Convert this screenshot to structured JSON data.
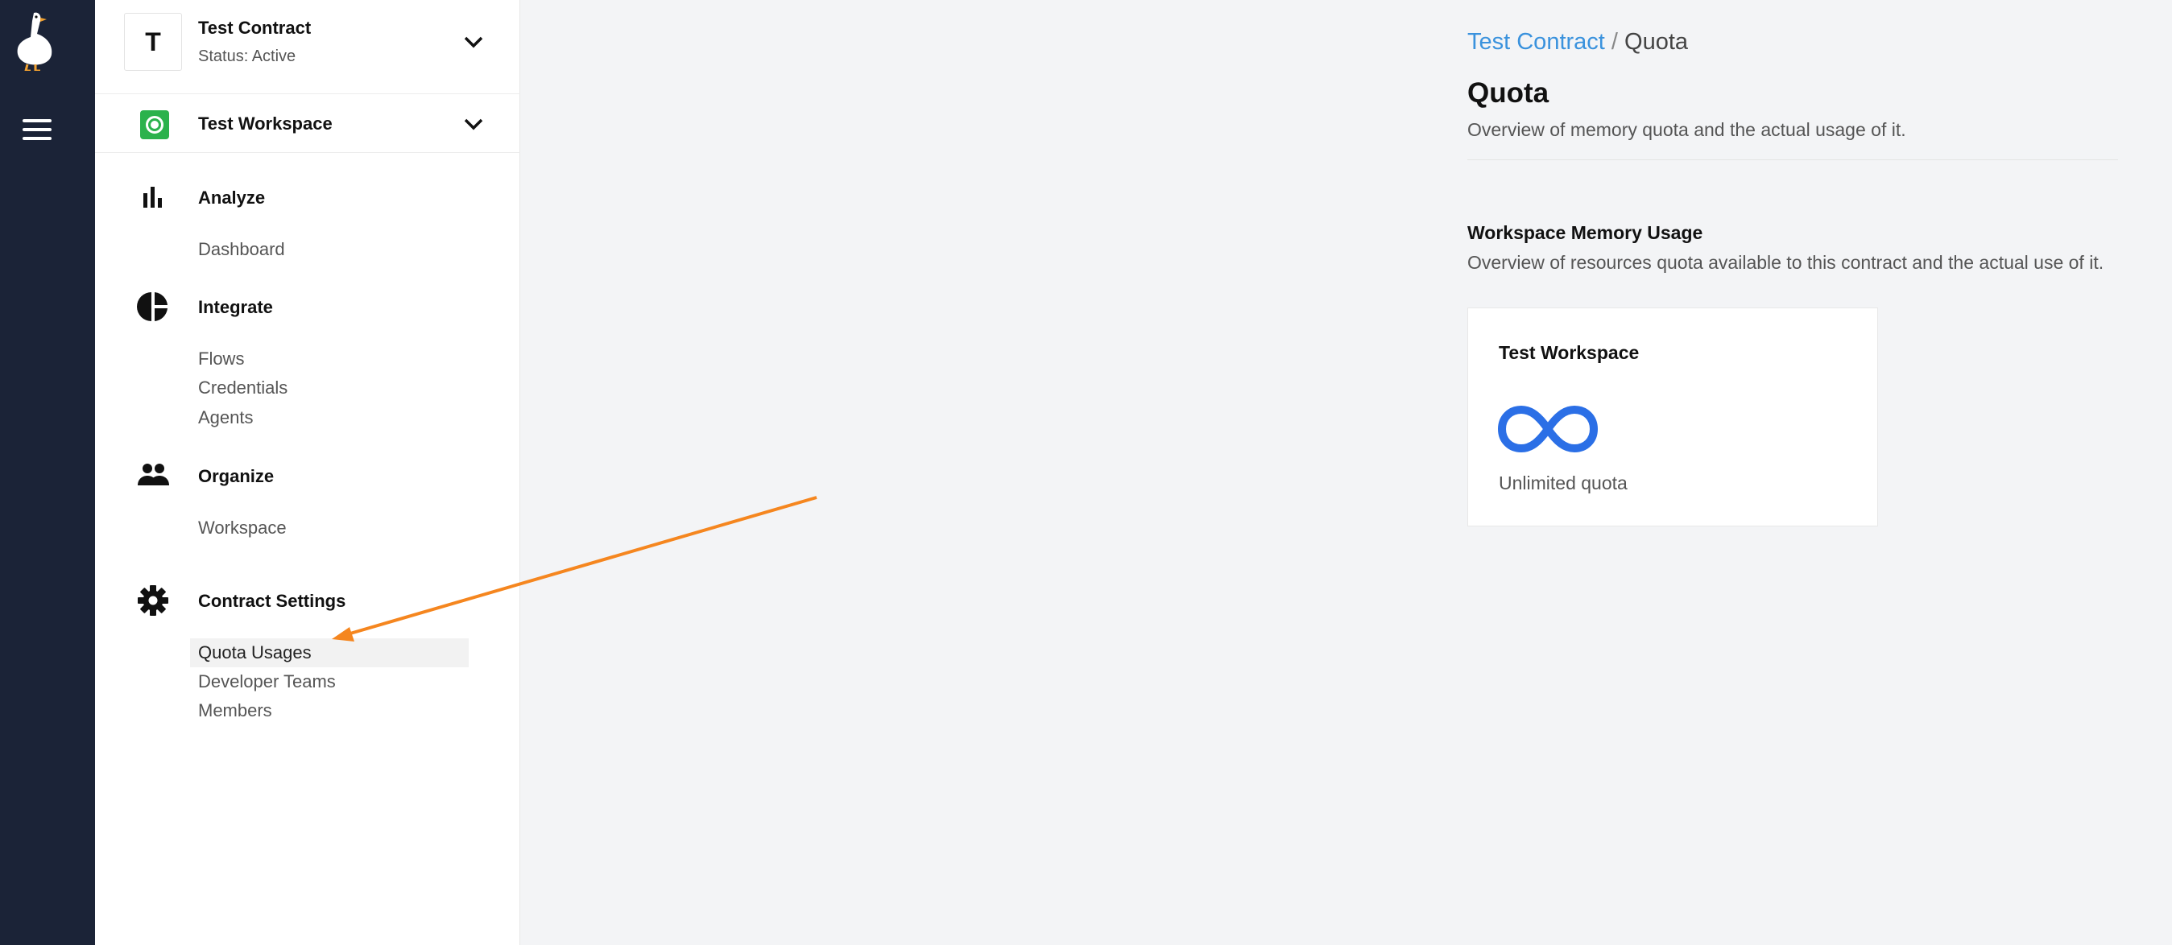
{
  "contract": {
    "avatar_letter": "T",
    "name": "Test Contract",
    "status": "Status: Active"
  },
  "workspace": {
    "name": "Test Workspace"
  },
  "nav": {
    "analyze": {
      "label": "Analyze",
      "items": [
        "Dashboard"
      ]
    },
    "integrate": {
      "label": "Integrate",
      "items": [
        "Flows",
        "Credentials",
        "Agents"
      ]
    },
    "organize": {
      "label": "Organize",
      "items": [
        "Workspace"
      ]
    },
    "contract_settings": {
      "label": "Contract Settings",
      "items": [
        "Quota Usages",
        "Developer Teams",
        "Members"
      ]
    }
  },
  "breadcrumb": {
    "link": "Test Contract",
    "separator": "/",
    "current": "Quota"
  },
  "page": {
    "title": "Quota",
    "subtitle": "Overview of memory quota and the actual usage of it."
  },
  "memory_section": {
    "title": "Workspace Memory Usage",
    "subtitle": "Overview of resources quota available to this contract and the actual use of it."
  },
  "quota_card": {
    "title": "Test Workspace",
    "icon": "infinity-icon",
    "text": "Unlimited quota"
  },
  "colors": {
    "rail": "#1b2337",
    "link": "#3a92dd",
    "accent_blue": "#2b6fe6",
    "workspace_green": "#2bb24c",
    "annotation_arrow": "#f5861f"
  }
}
